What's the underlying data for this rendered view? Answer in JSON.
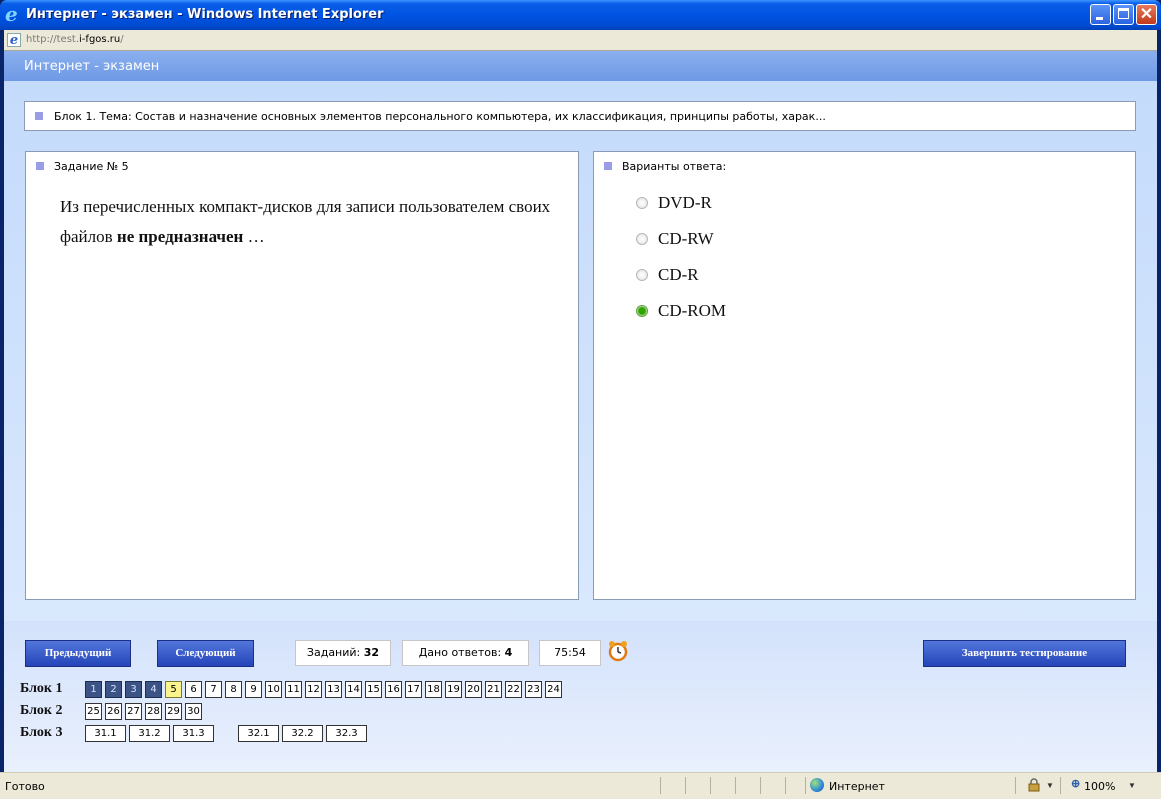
{
  "window": {
    "title": "Интернет - экзамен - Windows Internet Explorer"
  },
  "address": {
    "prefix": "http://test.",
    "host": "i-fgos.ru",
    "suffix": "/"
  },
  "header": {
    "title": "Интернет - экзамен"
  },
  "block_topic": "Блок 1. Тема: Состав и назначение основных элементов персонального компьютера, их классификация, принципы работы, харак...",
  "task": {
    "label": "Задание № 5",
    "text_part1": "Из перечисленных компакт-дисков для записи пользователем своих файлов ",
    "text_bold": "не предназначен",
    "text_part2": " …"
  },
  "answers": {
    "label": "Варианты ответа:",
    "options": [
      {
        "label": "DVD-R",
        "checked": false
      },
      {
        "label": "CD-RW",
        "checked": false
      },
      {
        "label": "CD-R",
        "checked": false
      },
      {
        "label": "CD-ROM",
        "checked": true
      }
    ]
  },
  "nav": {
    "prev_label": "Предыдущий",
    "next_label": "Следующий",
    "finish_label": "Завершить тестирование"
  },
  "stats": {
    "tasks_label": "Заданий:",
    "tasks_value": "32",
    "answered_label": "Дано ответов:",
    "answered_value": "4",
    "timer": "75:54"
  },
  "blocks": [
    {
      "label": "Блок 1",
      "cells": [
        "1",
        "2",
        "3",
        "4",
        "5",
        "6",
        "7",
        "8",
        "9",
        "10",
        "11",
        "12",
        "13",
        "14",
        "15",
        "16",
        "17",
        "18",
        "19",
        "20",
        "21",
        "22",
        "23",
        "24"
      ],
      "done": [
        "1",
        "2",
        "3",
        "4"
      ],
      "current": "5"
    },
    {
      "label": "Блок 2",
      "cells": [
        "25",
        "26",
        "27",
        "28",
        "29",
        "30"
      ]
    },
    {
      "label": "Блок 3",
      "cells_a": [
        "31.1",
        "31.2",
        "31.3"
      ],
      "cells_b": [
        "32.1",
        "32.2",
        "32.3"
      ]
    }
  ],
  "statusbar": {
    "status": "Готово",
    "zone": "Интернет",
    "zoom": "100%"
  }
}
